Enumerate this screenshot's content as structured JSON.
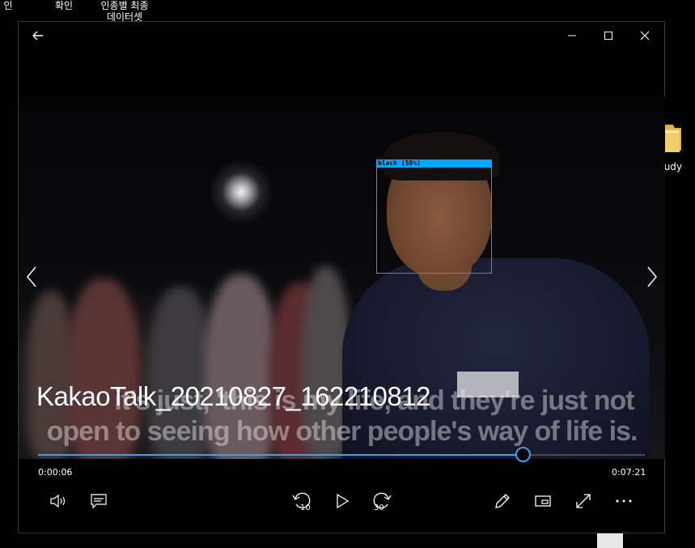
{
  "desktop": {
    "icons": [
      {
        "label": "인"
      },
      {
        "label": "확인"
      },
      {
        "label": "인종별 최종\n데이터셋"
      }
    ],
    "folder": {
      "label": "tudy",
      "icon": "folder-icon"
    }
  },
  "window": {
    "file_title": "KakaoTalk_20210827_162210812",
    "titlebar": {
      "back": "back-arrow-icon",
      "minimize": "minimize-icon",
      "maximize": "maximize-icon",
      "close": "close-icon"
    }
  },
  "video": {
    "subtitle_lines": [
      "it's just, 'this is my life, and they're just not",
      "open to seeing how other people's way of life is."
    ],
    "detection": {
      "label": "black (50%)",
      "color": "#00a8ff"
    }
  },
  "playback": {
    "current_time": "0:00:06",
    "total_time": "0:07:21",
    "progress": 0.8,
    "accent": "#3ea0ea"
  },
  "controls": {
    "left": [
      "volume-icon",
      "subtitles-icon"
    ],
    "center": [
      {
        "icon": "rewind-icon",
        "label": "10"
      },
      {
        "icon": "play-icon"
      },
      {
        "icon": "fast-forward-icon",
        "label": "30"
      }
    ],
    "right": [
      "edit-icon",
      "mini-view-icon",
      "fullscreen-icon",
      "more-icon"
    ]
  }
}
